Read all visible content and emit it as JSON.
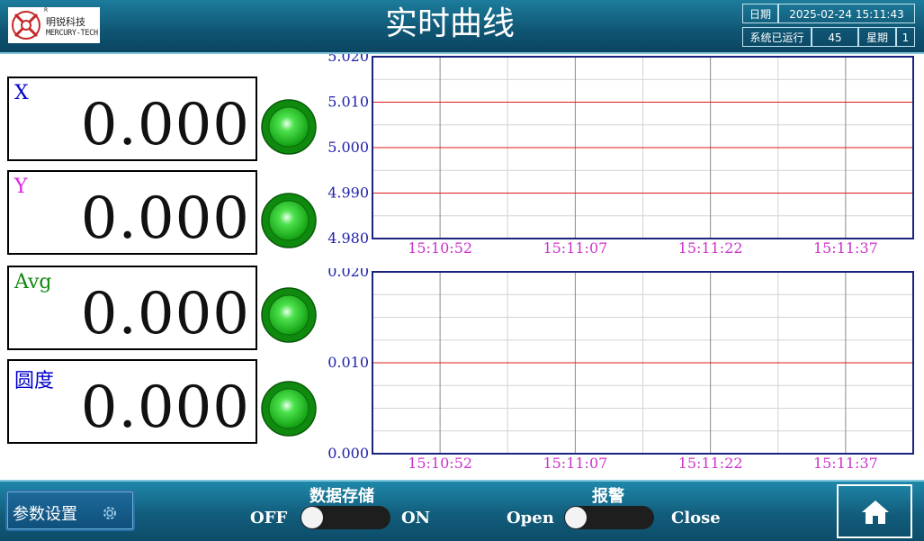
{
  "header": {
    "logo_cn": "明锐科技",
    "logo_en": "MERCURY-TECH",
    "logo_reg": "R",
    "title": "实时曲线",
    "date_label": "日期",
    "datetime": "2025-02-24 15:11:43",
    "uptime_label": "系统已运行",
    "uptime_value": "45",
    "week_label": "星期",
    "week_value": "1"
  },
  "readouts": [
    {
      "label": "X",
      "value": "0.000",
      "color": "#0000cc"
    },
    {
      "label": "Y",
      "value": "0.000",
      "color": "#e020e0"
    },
    {
      "label": "Avg",
      "value": "0.000",
      "color": "#118811"
    },
    {
      "label": "圆度",
      "value": "0.000",
      "color": "#0000cc"
    }
  ],
  "colors": {
    "lamp": "#22cc22",
    "axis_y_text": "#2222aa",
    "axis_x_text": "#cc33cc",
    "ref_line": "#e01818",
    "frame": "#1a237e"
  },
  "chart_data": [
    {
      "type": "line",
      "yticks": [
        "5.020",
        "5.010",
        "5.000",
        "4.990",
        "4.980"
      ],
      "ylim": [
        4.98,
        5.02
      ],
      "xticks": [
        "15:10:52",
        "15:11:07",
        "15:11:22",
        "15:11:37"
      ],
      "reference_lines": [
        5.01,
        5.0,
        4.99
      ],
      "series": []
    },
    {
      "type": "line",
      "yticks": [
        "0.020",
        "0.010",
        "0.000"
      ],
      "ylim": [
        0.0,
        0.02
      ],
      "xticks": [
        "15:10:52",
        "15:11:07",
        "15:11:22",
        "15:11:37"
      ],
      "reference_lines": [
        0.01
      ],
      "series": []
    }
  ],
  "footer": {
    "param_button": "参数设置",
    "data_storage_label": "数据存储",
    "storage_off": "OFF",
    "storage_on": "ON",
    "alarm_label": "报警",
    "alarm_open": "Open",
    "alarm_close": "Close"
  },
  "icons": {
    "home": "home-icon",
    "gear": "gear-icon",
    "logo": "logo-icon"
  }
}
